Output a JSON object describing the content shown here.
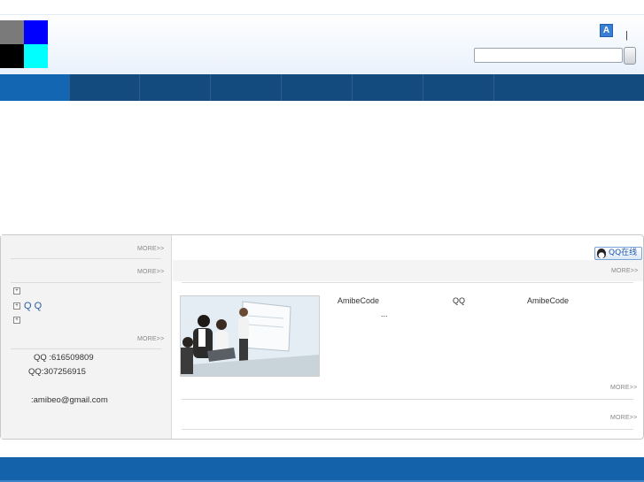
{
  "header": {
    "logo_colors": [
      "#7a7a7a",
      "#0000ff",
      "#000000",
      "#00ffff"
    ],
    "lang_icon": "A",
    "separator": "|",
    "search": {
      "value": "",
      "placeholder": ""
    }
  },
  "nav": {
    "item_count": 7,
    "active_index": 0,
    "color": "#134b7f",
    "active_color": "#1366b2"
  },
  "sidebar": {
    "more_1": "MORE>>",
    "more_2": "MORE>>",
    "tree": [
      {
        "icon": "expand-icon",
        "label": ""
      },
      {
        "icon": "expand-icon",
        "label": "Q Q"
      },
      {
        "icon": "expand-icon",
        "label": ""
      }
    ],
    "more_3": "MORE>>",
    "contact_qq1": "QQ :616509809",
    "contact_qq2": "QQ:307256915",
    "contact_email": ":amibeo@gmail.com"
  },
  "content": {
    "qq_online": "QQ在线",
    "more_head": "MORE>>",
    "intro_1": "AmibeCode",
    "intro_2": "QQ",
    "intro_3": "AmibeCode",
    "ellipsis": "...",
    "more_1": "MORE>>",
    "more_2": "MORE>>"
  },
  "footer": {
    "color": "#1462a9"
  }
}
